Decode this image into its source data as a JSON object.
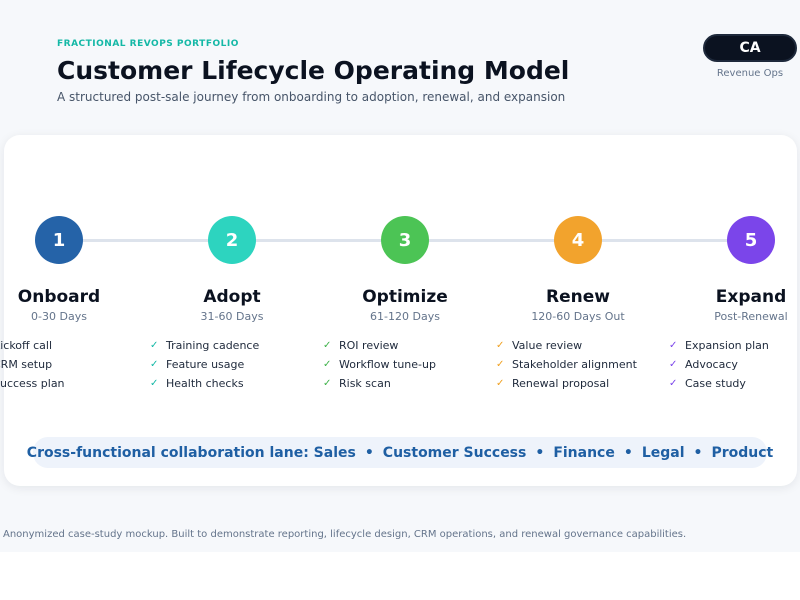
{
  "header": {
    "eyebrow": "FRACTIONAL REVOPS PORTFOLIO",
    "title": "Customer Lifecycle Operating Model",
    "subtitle": "A structured post-sale journey from onboarding to adoption, renewal, and expansion"
  },
  "badge": {
    "initials": "CA",
    "label": "Revenue Ops"
  },
  "check_icon": "✓",
  "steps": [
    {
      "number": "1",
      "title": "Onboard",
      "period": "0-30 Days",
      "color": "#2563a8",
      "check_color": "#2563a8",
      "items": [
        "Kickoff call",
        "CRM setup",
        "Success plan"
      ]
    },
    {
      "number": "2",
      "title": "Adopt",
      "period": "31-60 Days",
      "color": "#2dd4bf",
      "check_color": "#14b8a6",
      "items": [
        "Training cadence",
        "Feature usage",
        "Health checks"
      ]
    },
    {
      "number": "3",
      "title": "Optimize",
      "period": "61-120 Days",
      "color": "#4cc455",
      "check_color": "#3fb24a",
      "items": [
        "ROI review",
        "Workflow tune-up",
        "Risk scan"
      ]
    },
    {
      "number": "4",
      "title": "Renew",
      "period": "120-60 Days Out",
      "color": "#f2a32d",
      "check_color": "#f0a020",
      "items": [
        "Value review",
        "Stakeholder alignment",
        "Renewal proposal"
      ]
    },
    {
      "number": "5",
      "title": "Expand",
      "period": "Post-Renewal",
      "color": "#7b45ea",
      "check_color": "#7b45ea",
      "items": [
        "Expansion plan",
        "Advocacy",
        "Case study"
      ]
    }
  ],
  "lane": {
    "prefix": "Cross-functional collaboration lane: Sales",
    "items": [
      "Customer Success",
      "Finance",
      "Legal",
      "Product"
    ],
    "separator": "•"
  },
  "footer": "Anonymized case-study mockup. Built to demonstrate reporting, lifecycle design, CRM operations, and renewal governance capabilities."
}
